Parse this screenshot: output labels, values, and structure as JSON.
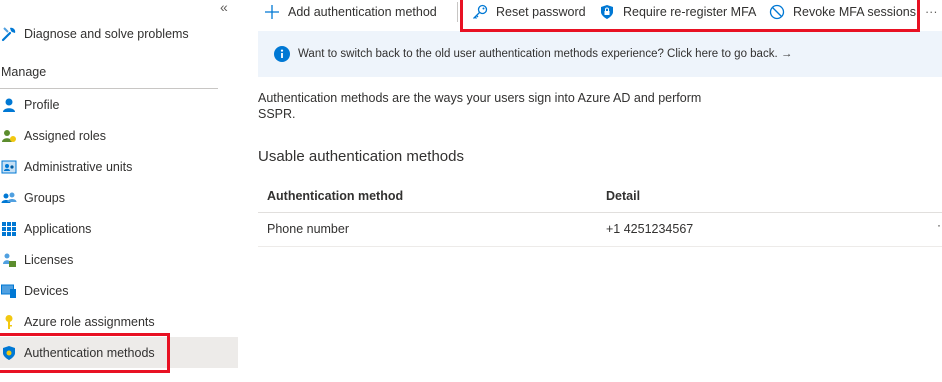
{
  "sidebar": {
    "collapse_glyph": "«",
    "top_item": {
      "label": "Diagnose and solve problems",
      "icon": "wrench-icon"
    },
    "section_header": "Manage",
    "items": [
      {
        "label": "Profile",
        "icon": "person-icon"
      },
      {
        "label": "Assigned roles",
        "icon": "assigned-roles-icon"
      },
      {
        "label": "Administrative units",
        "icon": "administrative-units-icon"
      },
      {
        "label": "Groups",
        "icon": "groups-icon"
      },
      {
        "label": "Applications",
        "icon": "applications-grid-icon"
      },
      {
        "label": "Licenses",
        "icon": "licenses-icon"
      },
      {
        "label": "Devices",
        "icon": "devices-icon"
      },
      {
        "label": "Azure role assignments",
        "icon": "key-icon"
      },
      {
        "label": "Authentication methods",
        "icon": "shield-icon",
        "selected": true
      }
    ]
  },
  "toolbar": {
    "add_label": "Add authentication method",
    "reset_label": "Reset password",
    "reregister_label": "Require re-register MFA",
    "revoke_label": "Revoke MFA sessions",
    "more_glyph": "···"
  },
  "banner": {
    "text": "Want to switch back to the old user authentication methods experience? Click here to go back. →"
  },
  "main": {
    "description": "Authentication methods are the ways your users sign into Azure AD and perform SSPR.",
    "section_title": "Usable authentication methods",
    "table": {
      "columns": [
        "Authentication method",
        "Detail"
      ],
      "rows": [
        {
          "method": "Phone number",
          "detail": "+1 4251234567",
          "more": "·"
        }
      ]
    }
  },
  "colors": {
    "accent": "#0078d4",
    "highlight": "#e81123",
    "banner_bg": "#eef4fb",
    "selected_bg": "#edebe9"
  }
}
